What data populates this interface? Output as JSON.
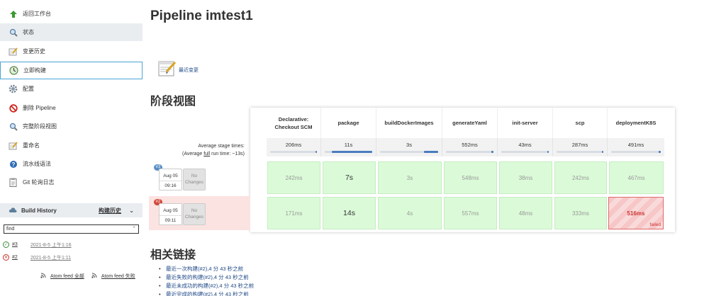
{
  "sidebar": {
    "items": [
      {
        "label": "返回工作台",
        "icon": "up-arrow-icon"
      },
      {
        "label": "状态",
        "icon": "magnifier-icon"
      },
      {
        "label": "变更历史",
        "icon": "notepad-icon"
      },
      {
        "label": "立即构建",
        "icon": "build-clock-icon"
      },
      {
        "label": "配置",
        "icon": "gear-icon"
      },
      {
        "label": "删除 Pipeline",
        "icon": "no-entry-icon"
      },
      {
        "label": "完整阶段视图",
        "icon": "magnifier-icon"
      },
      {
        "label": "重命名",
        "icon": "notepad-icon"
      },
      {
        "label": "流水线语法",
        "icon": "help-icon"
      },
      {
        "label": "Git 轮询日志",
        "icon": "clipboard-icon"
      }
    ]
  },
  "build_history": {
    "title": "Build History",
    "trend_label": "构建历史",
    "arrow": "⌄",
    "search_value": "find",
    "clear": "×",
    "builds": [
      {
        "number": "#3",
        "date": "2021-8-5 上午1:16",
        "status": "success"
      },
      {
        "number": "#2",
        "date": "2021-8-5 上午1:11",
        "status": "failed"
      }
    ],
    "feed_all": "Atom feed 全部",
    "feed_failed": "Atom feed 失败"
  },
  "main": {
    "title": "Pipeline imtest1",
    "recent_changes": "最近变更",
    "stage_view_title": "阶段视图",
    "related_links_title": "相关链接"
  },
  "stage_view": {
    "avg_label_line1": "Average stage times:",
    "avg_label_prefix": "(Average ",
    "avg_label_full": "full",
    "avg_label_suffix": " run time: ~13s)",
    "stages": [
      {
        "name": "Declarative: Checkout SCM",
        "avg": "206ms",
        "avg_fraction": 0.0
      },
      {
        "name": "package",
        "avg": "11s",
        "avg_fraction": 0.85
      },
      {
        "name": "buildDockerImages",
        "avg": "3s",
        "avg_fraction": 0.25
      },
      {
        "name": "generateYaml",
        "avg": "552ms",
        "avg_fraction": 0.04
      },
      {
        "name": "init-server",
        "avg": "43ms",
        "avg_fraction": 0.01
      },
      {
        "name": "scp",
        "avg": "287ms",
        "avg_fraction": 0.02
      },
      {
        "name": "deploymentK8S",
        "avg": "491ms",
        "avg_fraction": 0.04
      }
    ],
    "runs": [
      {
        "badge": "#3",
        "month_day": "Aug 05",
        "time": "09:16",
        "changes": "No Changes",
        "status": "success",
        "durations": [
          "242ms",
          "7s",
          "3s",
          "548ms",
          "38ms",
          "242ms",
          "467ms"
        ]
      },
      {
        "badge": "#2",
        "month_day": "Aug 05",
        "time": "09:11",
        "changes": "No Changes",
        "status": "failed",
        "durations": [
          "171ms",
          "14s",
          "4s",
          "557ms",
          "48ms",
          "333ms",
          "516ms"
        ],
        "failed_label": "failed"
      }
    ]
  },
  "related_links": [
    "最近一次构建(#2),4 分 43 秒之前",
    "最近失败的构建(#2),4 分 43 秒之前",
    "最近未成功的构建(#2),4 分 43 秒之前",
    "最近完成的构建(#2),4 分 43 秒之前"
  ],
  "colors": {
    "accent": "#4ca4d6",
    "success_cell": "#dbfbd8",
    "failed_cell": "#f7c6c6",
    "failed_row": "#fbe3e1",
    "badge": "#5a8fc5",
    "badge_failed": "#d24939",
    "link": "#204a87"
  }
}
